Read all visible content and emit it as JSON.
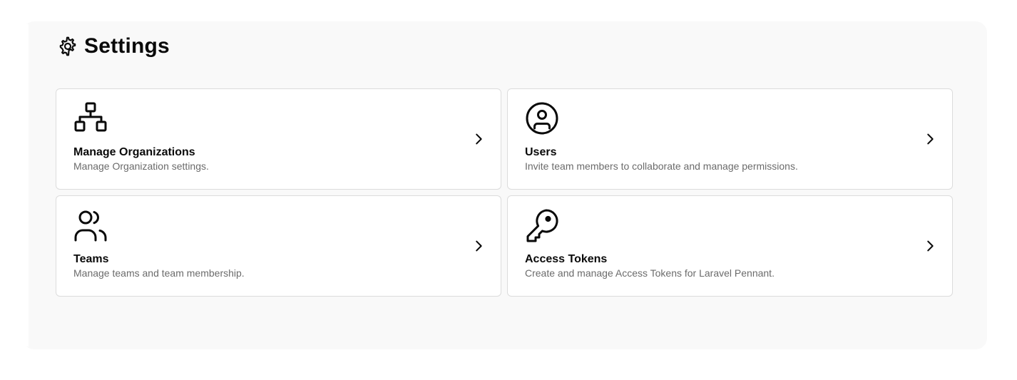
{
  "header": {
    "title": "Settings",
    "icon": "gear-icon"
  },
  "cards": [
    {
      "title": "Manage Organizations",
      "description": "Manage Organization settings.",
      "icon": "org-chart-icon"
    },
    {
      "title": "Users",
      "description": "Invite team members to collaborate and manage permissions.",
      "icon": "user-circle-icon"
    },
    {
      "title": "Teams",
      "description": "Manage teams and team membership.",
      "icon": "users-icon"
    },
    {
      "title": "Access Tokens",
      "description": "Create and manage Access Tokens for Laravel Pennant.",
      "icon": "key-icon"
    }
  ],
  "colors": {
    "panel_background": "#f9f9f9",
    "card_border": "#dcdcdc",
    "title_text": "#0a0a0a",
    "description_text": "#6b6b6b"
  }
}
